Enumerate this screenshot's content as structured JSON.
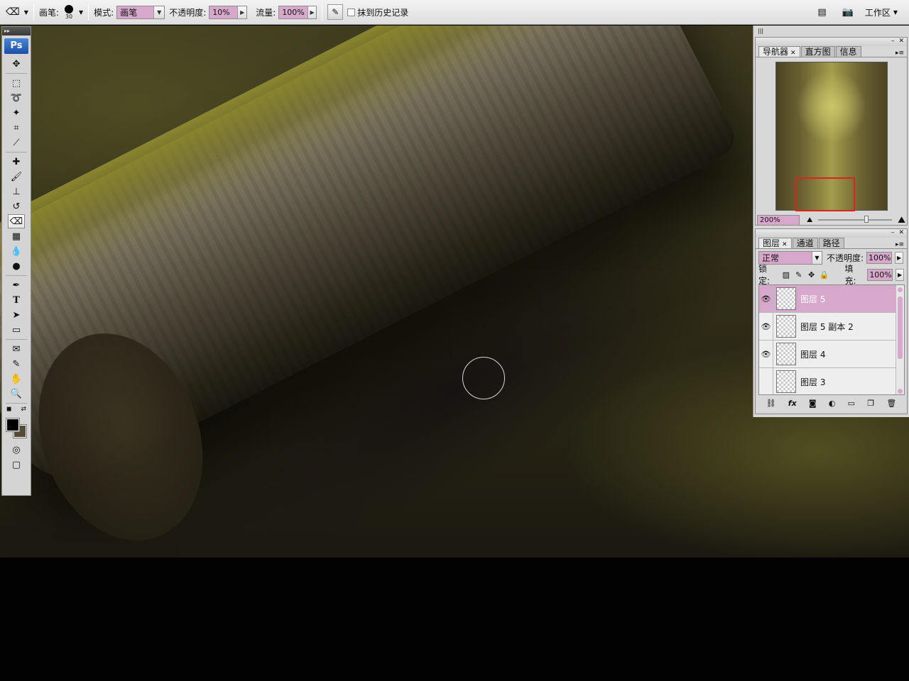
{
  "options_bar": {
    "brush_label": "画笔:",
    "brush_size": "30",
    "mode_label": "模式:",
    "mode_value": "画笔",
    "opacity_label": "不透明度:",
    "opacity_value": "10%",
    "flow_label": "流量:",
    "flow_value": "100%",
    "erase_to_history_label": "抹到历史记录",
    "workspace_label": "工作区"
  },
  "toolbox": {
    "logo": "Ps",
    "tools": [
      "move",
      "marquee",
      "lasso",
      "magic-wand",
      "crop",
      "slice",
      "healing",
      "brush",
      "clone-stamp",
      "history-brush",
      "eraser",
      "gradient",
      "blur",
      "dodge",
      "pen",
      "type",
      "path-select",
      "shape",
      "notes",
      "eyedropper",
      "hand",
      "zoom"
    ],
    "active_tool": "eraser",
    "foreground_color": "#000000",
    "background_color": "#554d33"
  },
  "navigator_panel": {
    "tabs": [
      "导航器",
      "直方图",
      "信息"
    ],
    "active_tab": "导航器",
    "zoom": "200%"
  },
  "layers_panel": {
    "tabs": [
      "图层",
      "通道",
      "路径"
    ],
    "active_tab": "图层",
    "blend_mode": "正常",
    "opacity_label": "不透明度:",
    "opacity_value": "100%",
    "lock_label": "锁定:",
    "fill_label": "填充:",
    "fill_value": "100%",
    "layers": [
      {
        "name": "图层 5",
        "visible": true,
        "selected": true
      },
      {
        "name": "图层 5 副本 2",
        "visible": true,
        "selected": false
      },
      {
        "name": "图层 4",
        "visible": true,
        "selected": false
      },
      {
        "name": "图层 3",
        "visible": false,
        "selected": false
      }
    ],
    "footer_icons": [
      "link-icon",
      "fx-icon",
      "mask-icon",
      "adjustment-icon",
      "group-icon",
      "new-layer-icon",
      "trash-icon"
    ]
  },
  "colors": {
    "accent": "#d8a8cc",
    "nav_box": "#e0221c"
  }
}
